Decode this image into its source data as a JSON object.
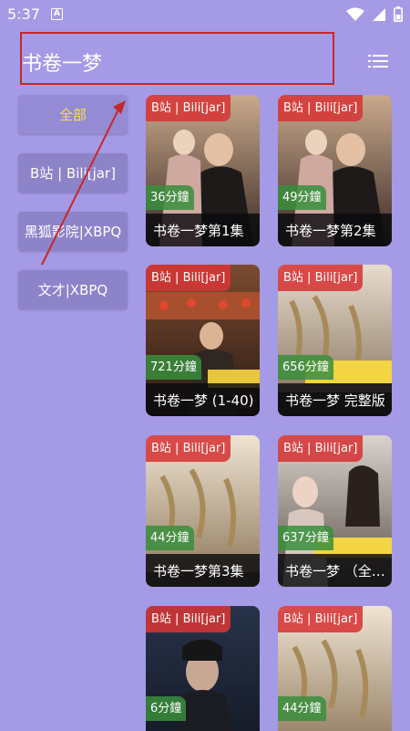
{
  "status_bar": {
    "time": "5:37",
    "app_icon": "A"
  },
  "header": {
    "title": "书卷一梦"
  },
  "colors": {
    "background": "#a59ae6",
    "highlight": "#c62828",
    "active_text": "#f7e04a",
    "badge": "#d63636",
    "duration": "#388e3c"
  },
  "sidebar": {
    "items": [
      {
        "label": "全部",
        "active": true
      },
      {
        "label": "B站 | Bili[jar]",
        "active": false
      },
      {
        "label": "黑狐影院|XBPQ",
        "active": false
      },
      {
        "label": "文才|XBPQ",
        "active": false
      }
    ]
  },
  "cards": [
    {
      "badge": "B站 | Bili[jar]",
      "duration": "36分鐘",
      "title": "书卷一梦第1集"
    },
    {
      "badge": "B站 | Bili[jar]",
      "duration": "49分鐘",
      "title": "书卷一梦第2集"
    },
    {
      "badge": "B站 | Bili[jar]",
      "duration": "721分鐘",
      "title": "书卷一梦 (1-40)"
    },
    {
      "badge": "B站 | Bili[jar]",
      "duration": "656分鐘",
      "title": "书卷一梦 完整版"
    },
    {
      "badge": "B站 | Bili[jar]",
      "duration": "44分鐘",
      "title": "书卷一梦第3集"
    },
    {
      "badge": "B站 | Bili[jar]",
      "duration": "637分鐘",
      "title": "书卷一梦 （全集）"
    },
    {
      "badge": "B站 | Bili[jar]",
      "duration": "6分鐘",
      "title": ""
    },
    {
      "badge": "B站 | Bili[jar]",
      "duration": "44分鐘",
      "title": ""
    }
  ],
  "icons": {
    "wifi": "wifi-icon",
    "signal": "cellular-signal-icon",
    "battery": "battery-icon",
    "menu": "list-menu-icon",
    "arrow": "annotation-arrow-icon"
  }
}
